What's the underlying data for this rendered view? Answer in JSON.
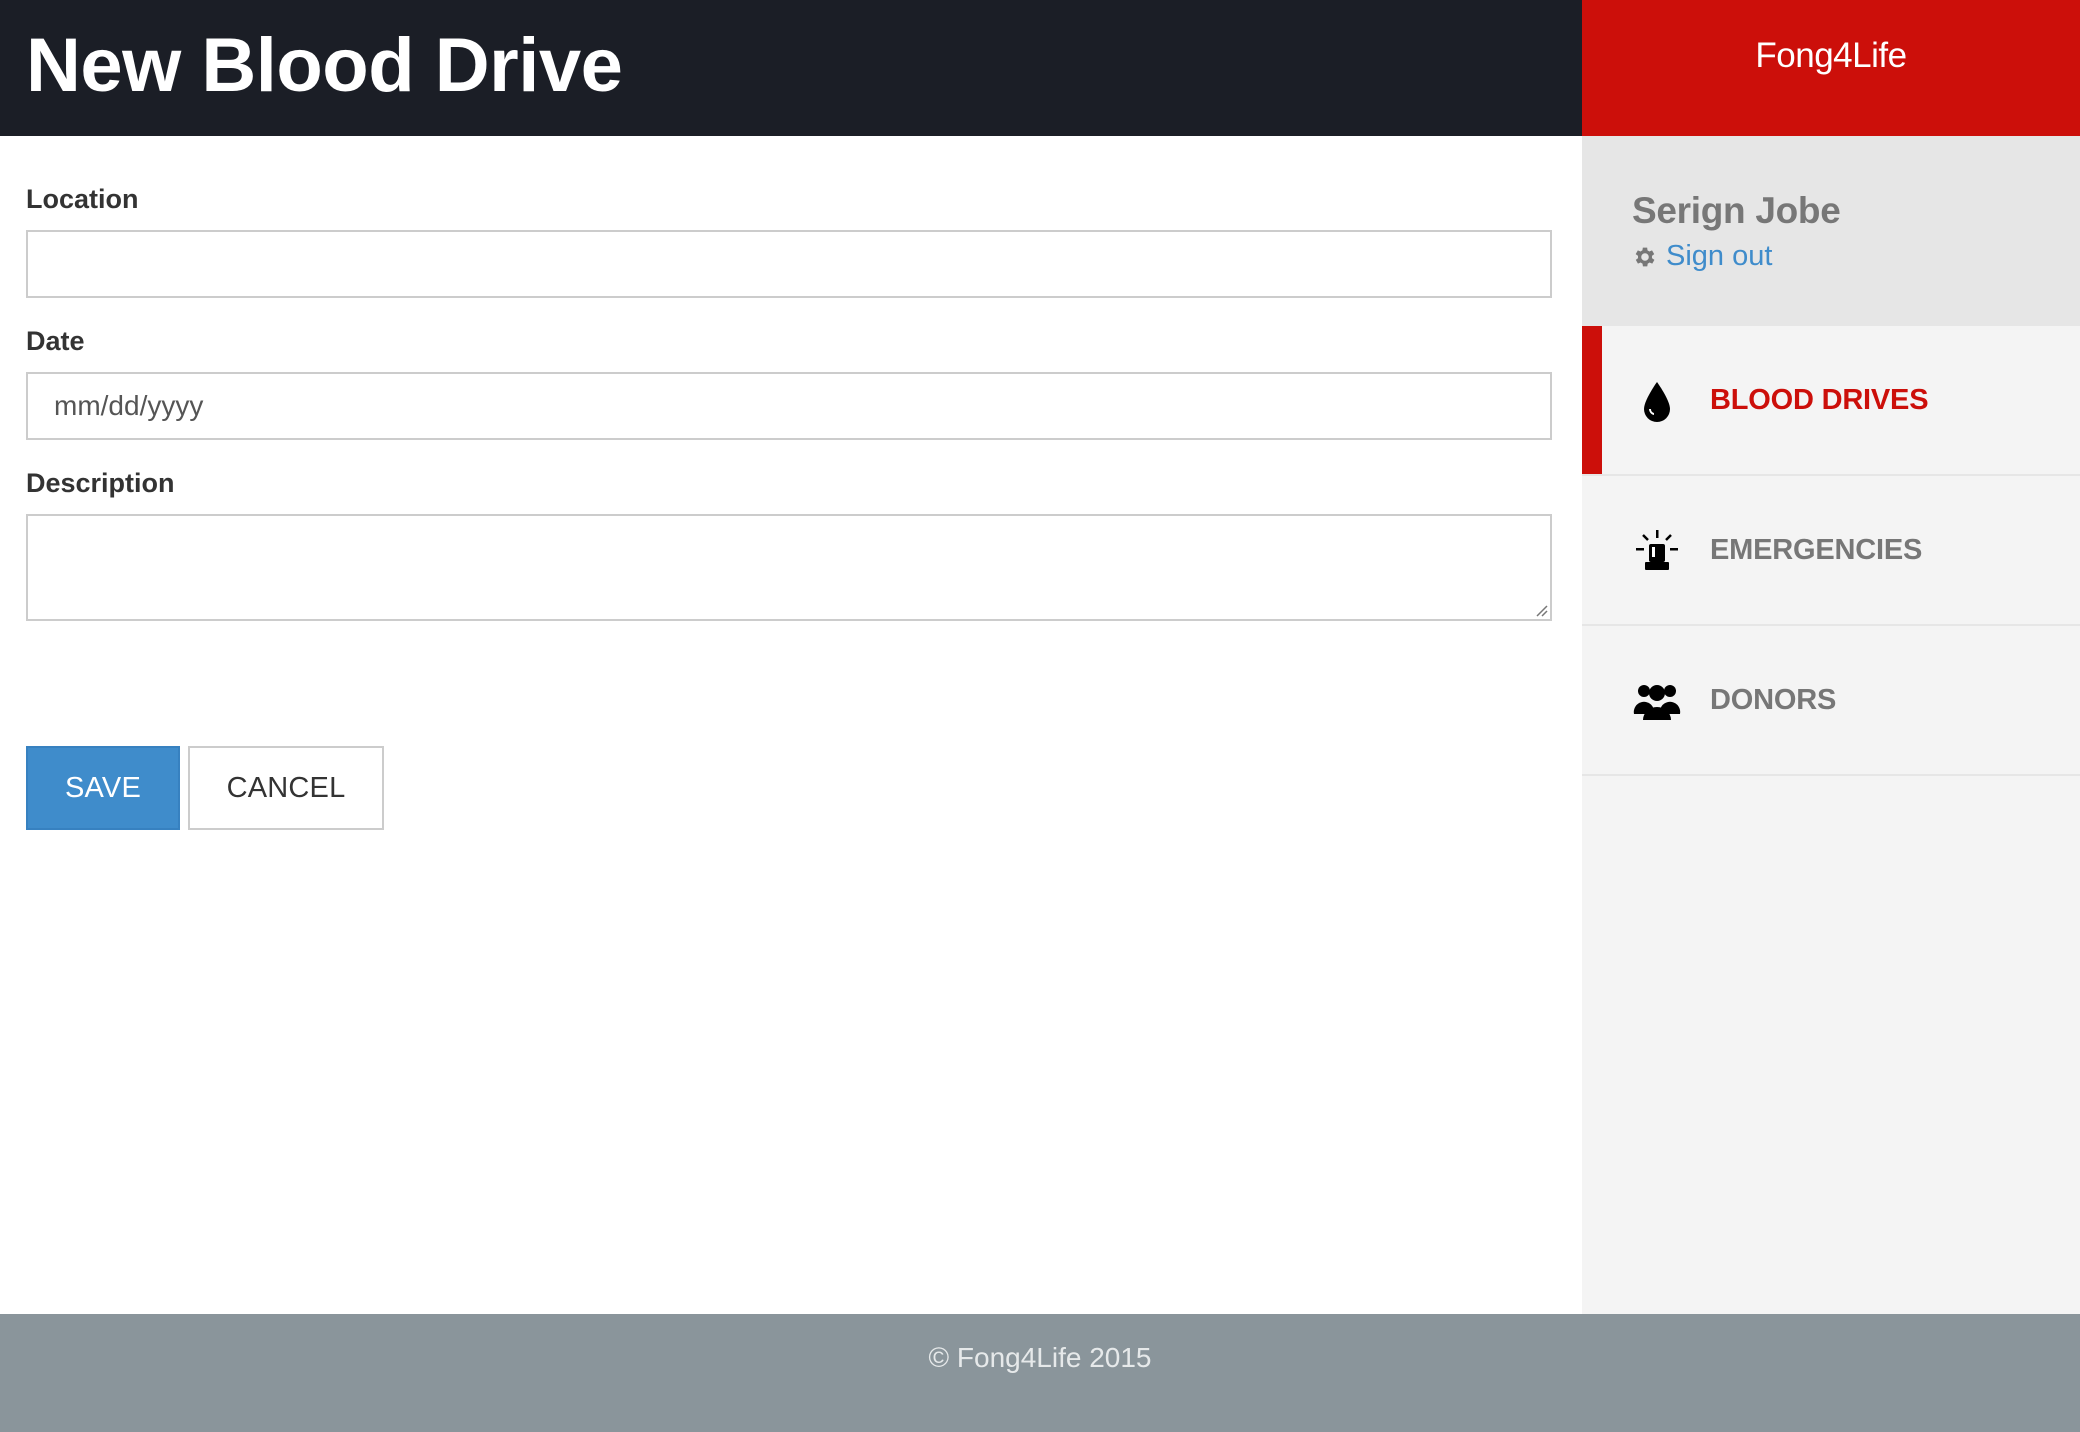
{
  "header": {
    "title": "New Blood Drive"
  },
  "brand": {
    "name": "Fong4Life"
  },
  "form": {
    "location": {
      "label": "Location",
      "value": "",
      "placeholder": ""
    },
    "date": {
      "label": "Date",
      "value": "",
      "placeholder": "mm/dd/yyyy"
    },
    "description": {
      "label": "Description",
      "value": "",
      "placeholder": ""
    },
    "save_label": "SAVE",
    "cancel_label": "CANCEL"
  },
  "user": {
    "name": "Serign Jobe",
    "signout_label": "Sign out",
    "signout_icon": "gear-icon"
  },
  "sidebar": {
    "items": [
      {
        "label": "BLOOD DRIVES",
        "icon": "blood-drop-icon",
        "active": true
      },
      {
        "label": "EMERGENCIES",
        "icon": "siren-icon",
        "active": false
      },
      {
        "label": "DONORS",
        "icon": "users-icon",
        "active": false
      }
    ]
  },
  "footer": {
    "text": "© Fong4Life 2015"
  },
  "colors": {
    "header_bg": "#1b1e26",
    "brand_red": "#cc0f0a",
    "primary_blue": "#3f8ccb",
    "footer_bg": "#8a959b",
    "sidebar_bg": "#f4f4f4"
  }
}
